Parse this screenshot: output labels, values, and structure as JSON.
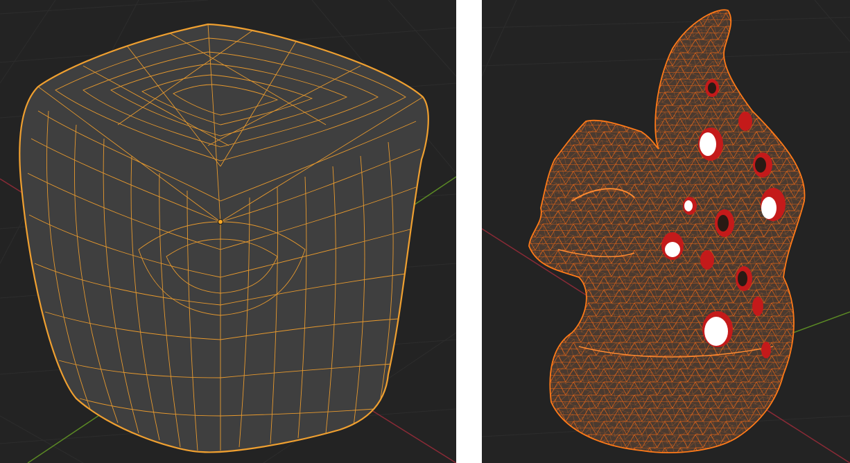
{
  "viewports": [
    {
      "object_name": "",
      "shading": "solid",
      "overlay": "wireframe",
      "edit_mode": true,
      "mesh": "subdivided-cube",
      "colors": {
        "background": "#232323",
        "grid": "#2d2d2d",
        "axis_x": "#8a2a36",
        "axis_y": "#5b8a24",
        "surface": "#3f3f3f",
        "wire": "#e89a2e",
        "outline": "#f0a030",
        "selected_vertex": "#f5a623"
      }
    },
    {
      "object_name": "",
      "shading": "solid",
      "overlay": "wireframe",
      "edit_mode": false,
      "mesh": "sculpt-with-holes",
      "colors": {
        "background": "#232323",
        "grid": "#2d2d2d",
        "axis_x": "#8a2a36",
        "axis_y": "#5b8a24",
        "surface": "#4a3a30",
        "wire": "#ff6a10",
        "hole": "#ffffff",
        "hole_inner": "#c41a1a"
      }
    }
  ]
}
